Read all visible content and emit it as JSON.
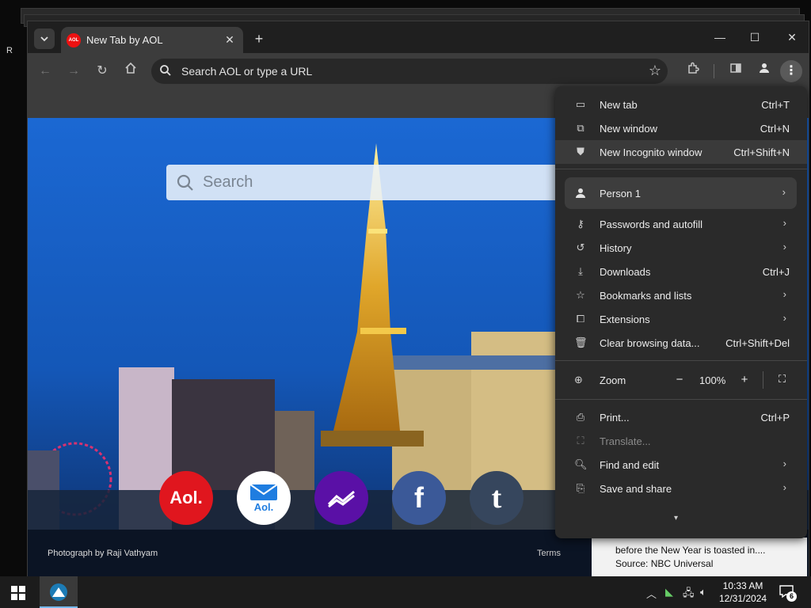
{
  "browser": {
    "tab_title": "New Tab by AOL",
    "tab_favicon_text": "AOL",
    "omnibox_placeholder": "Search AOL or type a URL"
  },
  "page": {
    "search_placeholder": "Search",
    "photo_credit": "Photograph by Raji Vathyam",
    "terms_label": "Terms",
    "quick_links": [
      {
        "name": "aol",
        "label": "Aol.",
        "color": "#e0161e"
      },
      {
        "name": "aol-mail",
        "label": "Aol.",
        "color": "#ffffff"
      },
      {
        "name": "finance",
        "label": "",
        "color": "#5a10a6"
      },
      {
        "name": "facebook",
        "label": "f",
        "color": "#3b5998"
      },
      {
        "name": "tumblr",
        "label": "t",
        "color": "#36465d"
      }
    ],
    "news_lines": [
      "before the New Year is toasted in....",
      "Source: NBC Universal"
    ]
  },
  "menu": {
    "items_top": [
      {
        "label": "New tab",
        "shortcut": "Ctrl+T"
      },
      {
        "label": "New window",
        "shortcut": "Ctrl+N"
      },
      {
        "label": "New Incognito window",
        "shortcut": "Ctrl+Shift+N"
      }
    ],
    "person": "Person 1",
    "items_mid": [
      {
        "label": "Passwords and autofill",
        "shortcut": ""
      },
      {
        "label": "History",
        "shortcut": ""
      },
      {
        "label": "Downloads",
        "shortcut": "Ctrl+J"
      },
      {
        "label": "Bookmarks and lists",
        "shortcut": ""
      },
      {
        "label": "Extensions",
        "shortcut": ""
      },
      {
        "label": "Clear browsing data...",
        "shortcut": "Ctrl+Shift+Del"
      }
    ],
    "zoom_label": "Zoom",
    "zoom_value": "100%",
    "items_bottom": [
      {
        "label": "Print...",
        "shortcut": "Ctrl+P"
      },
      {
        "label": "Translate...",
        "shortcut": ""
      },
      {
        "label": "Find and edit",
        "shortcut": ""
      },
      {
        "label": "Save and share",
        "shortcut": ""
      }
    ]
  },
  "taskbar": {
    "time": "10:33 AM",
    "date": "12/31/2024",
    "notification_count": "6"
  }
}
